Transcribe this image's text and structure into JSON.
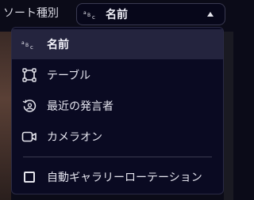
{
  "sort": {
    "label": "ソート種別",
    "selected_value": "名前"
  },
  "menu": {
    "items": [
      {
        "label": "名前",
        "icon": "name-sort-icon",
        "selected": true
      },
      {
        "label": "テーブル",
        "icon": "table-layout-icon",
        "selected": false
      },
      {
        "label": "最近の発言者",
        "icon": "recent-speaker-icon",
        "selected": false
      },
      {
        "label": "カメラオン",
        "icon": "camera-icon",
        "selected": false
      }
    ],
    "auto_rotation": {
      "label": "自動ギャラリーローテーション",
      "checked": false
    }
  },
  "colors": {
    "background": "#0a0a22",
    "selected_row": "#24243e",
    "text": "#e4e4ee"
  }
}
